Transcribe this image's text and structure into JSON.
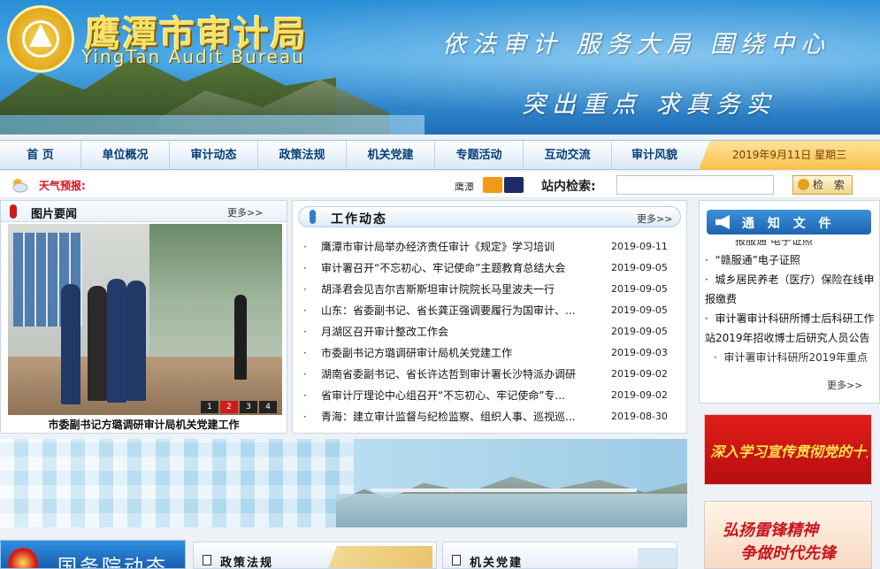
{
  "header": {
    "title": "鹰潭市审计局",
    "title_en": "YingTan Audit Bureau",
    "slogan_line1": "依法审计   服务大局   围绕中心",
    "slogan_line2": "突出重点   求真务实"
  },
  "nav": {
    "items": [
      {
        "label": "首  页"
      },
      {
        "label": "单位概况"
      },
      {
        "label": "审计动态"
      },
      {
        "label": "政策法规"
      },
      {
        "label": "机关党建"
      },
      {
        "label": "专题活动"
      },
      {
        "label": "互动交流"
      },
      {
        "label": "审计风貌"
      }
    ],
    "date": "2019年9月11日  星期三"
  },
  "search_row": {
    "weather_label": "天气预报:",
    "city": "鹰潭",
    "search_label": "站内检索:",
    "search_value": "",
    "search_button": "检 索"
  },
  "photo_news": {
    "title": "图片要闻",
    "more": "更多>>",
    "dots": [
      "1",
      "2",
      "3",
      "4"
    ],
    "active_dot": 1,
    "caption": "市委副书记方璐调研审计局机关党建工作"
  },
  "work_news": {
    "title": "工作动态",
    "more": "更多>>",
    "items": [
      {
        "text": "鹰潭市审计局举办经济责任审计《规定》学习培训",
        "date": "2019-09-11"
      },
      {
        "text": "审计署召开“不忘初心、牢记使命”主题教育总结大会",
        "date": "2019-09-05"
      },
      {
        "text": "胡泽君会见吉尔吉斯斯坦审计院院长马里波夫一行",
        "date": "2019-09-05"
      },
      {
        "text": "山东：省委副书记、省长龚正强调要履行为国审计、...",
        "date": "2019-09-05"
      },
      {
        "text": "月湖区召开审计整改工作会",
        "date": "2019-09-05"
      },
      {
        "text": "市委副书记方璐调研审计局机关党建工作",
        "date": "2019-09-03"
      },
      {
        "text": "湖南省委副书记、省长许达哲到审计署长沙特派办调研",
        "date": "2019-09-02"
      },
      {
        "text": "省审计厅理论中心组召开“不忘初心、牢记使命”专...",
        "date": "2019-09-02"
      },
      {
        "text": "青海：建立审计监督与纪检监察、组织人事、巡视巡...",
        "date": "2019-08-30"
      }
    ]
  },
  "notice": {
    "title": "通 知 文 件",
    "clip_top": "报服通 电子证照",
    "items": [
      {
        "text": "“赣服通”电子证照"
      },
      {
        "text": "城乡居民养老（医疗）保险在线申报缴费"
      },
      {
        "text": "审计署审计科研所博士后科研工作站2019年招收博士后研究人员公告"
      }
    ],
    "clip_bottom": "审计署审计科研所2019年重点",
    "more": "更多>>"
  },
  "ads": {
    "ad1_text": "深入学习宣传贯彻党的十九大精神",
    "ad2_line1": "弘扬雷锋精神",
    "ad2_line2": "争做时代先锋"
  },
  "bottom": {
    "state_council": "国务院动态",
    "policy": "政策法规",
    "party": "机关党建"
  }
}
